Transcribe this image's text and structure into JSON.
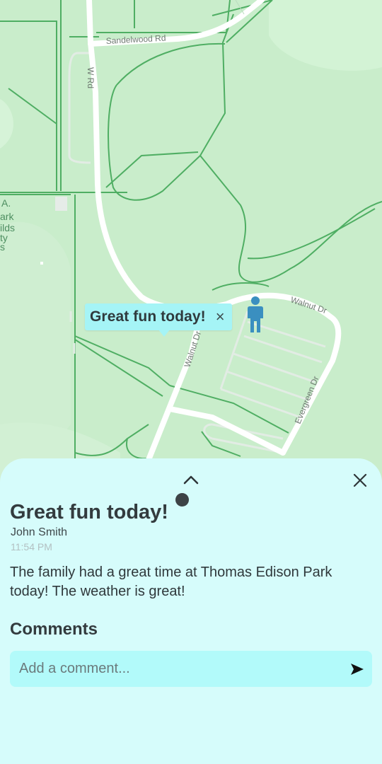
{
  "map": {
    "roads": {
      "sandelwood": "Sandelwood Rd",
      "w_rd": "W Rd",
      "walnut_dr_top": "Walnut Dr",
      "walnut_dr_side": "Walnut Dr",
      "evergreen_dr": "Evergreen Dr"
    },
    "park_label_lines": [
      "A.",
      "ark",
      "ilds",
      "ty",
      "s"
    ],
    "colors": {
      "park": "#c8ecc9",
      "road": "#ffffff",
      "path": "#4aa85c",
      "bubble": "#a5f4f6",
      "pin": "#3a8fc0"
    }
  },
  "bubble": {
    "title": "Great fun today!",
    "close_icon": "×"
  },
  "post": {
    "title": "Great fun today!",
    "author": "John Smith",
    "time": "11:54 PM",
    "body": "The family had a great time at Thomas Edison Park today! The weather is great!"
  },
  "comments": {
    "heading": "Comments",
    "placeholder": "Add a comment..."
  },
  "colors": {
    "sheet": "#d6fcfb",
    "comment_box": "#b2fafa"
  }
}
